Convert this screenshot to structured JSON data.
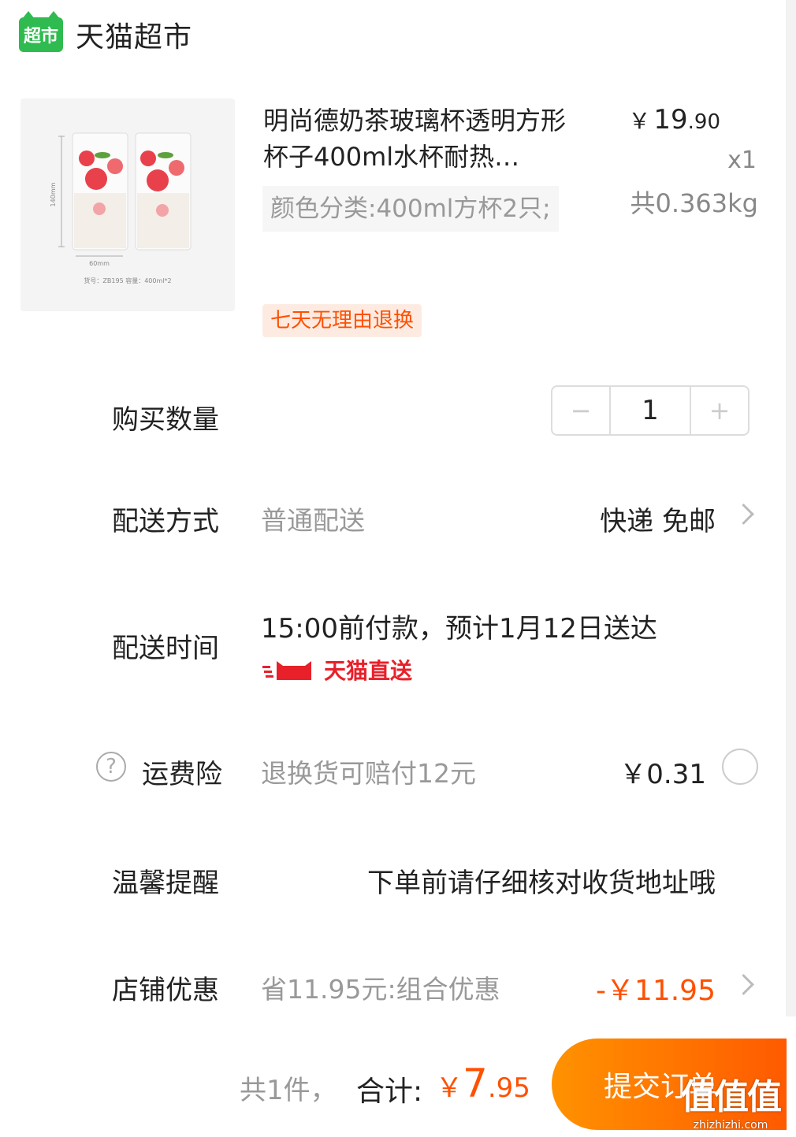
{
  "store": {
    "logo_text": "超市",
    "name": "天猫超市",
    "logo_color": "#2fbb4f"
  },
  "product": {
    "title": "明尚德奶茶玻璃杯透明方形杯子400ml水杯耐热…",
    "sku": "颜色分类:400ml方杯2只;",
    "price_currency": "￥",
    "price_int": "19",
    "price_dec": ".90",
    "quantity": "x1",
    "weight": "共0.363kg",
    "return_badge": "七天无理由退换",
    "image_labels": {
      "height": "140mm",
      "width": "60mm",
      "caption": "货号：ZB195   容量：400ml*2"
    }
  },
  "quantity_row": {
    "label": "购买数量",
    "minus": "−",
    "value": "1",
    "plus": "+"
  },
  "delivery_method": {
    "label": "配送方式",
    "value": "普通配送",
    "option": "快递 免邮"
  },
  "delivery_time": {
    "label": "配送时间",
    "text": "15:00前付款，预计1月12日送达",
    "badge": "天猫直送",
    "badge_color": "#e8202a"
  },
  "shipping_insurance": {
    "icon": "?",
    "label": "运费险",
    "description": "退换货可赔付12元",
    "price": "￥0.31"
  },
  "reminder": {
    "label": "温馨提醒",
    "text": "下单前请仔细核对收货地址哦"
  },
  "store_discount": {
    "label": "店铺优惠",
    "description": "省11.95元:组合优惠",
    "amount": "-￥11.95",
    "accent": "#ff5000"
  },
  "footer": {
    "count": "共1件，",
    "total_label": "合计:",
    "total_currency": "￥",
    "total_int": "7",
    "total_dec": ".95",
    "submit": "提交订单",
    "watermark": "值值值",
    "watermark_url": "zhizhizhi.com"
  }
}
